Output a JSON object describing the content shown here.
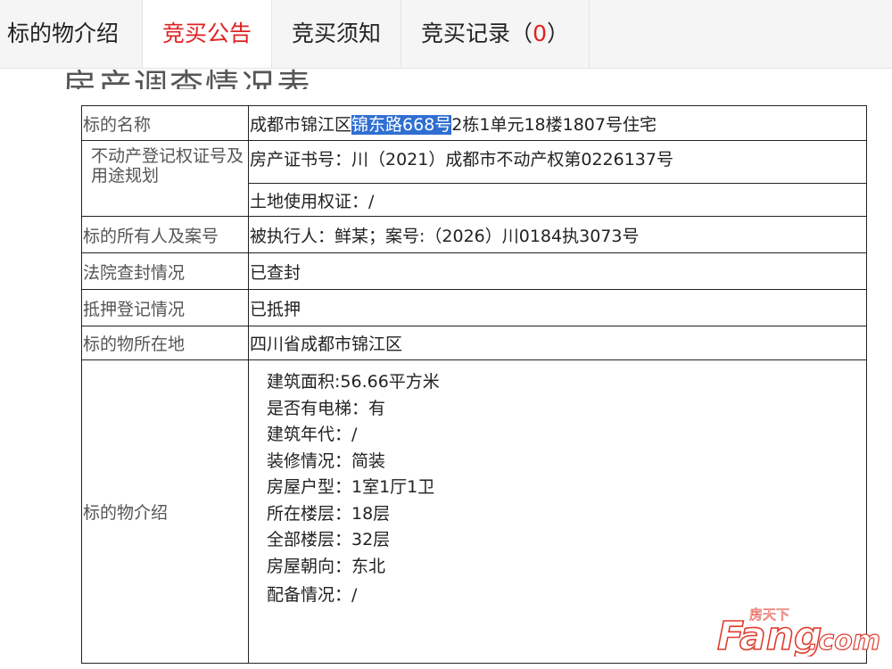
{
  "tabs": [
    {
      "label": "标的物介绍"
    },
    {
      "label": "竞买公告"
    },
    {
      "label": "竞买须知"
    },
    {
      "label": "竞买记录（",
      "count": "0",
      "suffix": "）"
    }
  ],
  "heading": "房产调查情况表",
  "table": {
    "name": {
      "label": "标的名称",
      "prefix": "成都市锦江区",
      "highlight": "锦东路668号",
      "suffix": "2栋1单元18楼1807号住宅"
    },
    "cert": {
      "label": "不动产登记权证号及用途规划",
      "property_cert": "房产证书号：川（2021）成都市不动产权第0226137号",
      "land_cert": "土地使用权证：/"
    },
    "owner": {
      "label": "标的所有人及案号",
      "value": "被执行人：鲜某；案号:（2026）川0184执3073号"
    },
    "seizure": {
      "label": "法院查封情况",
      "value": "已查封"
    },
    "mortgage": {
      "label": "抵押登记情况",
      "value": "已抵押"
    },
    "location": {
      "label": "标的物所在地",
      "value": "四川省成都市锦江区"
    },
    "intro": {
      "label": "标的物介绍",
      "items": [
        "建筑面积:56.66平方米",
        "是否有电梯：有",
        "建筑年代：/",
        "装修情况：简装",
        "房屋户型：1室1厅1卫",
        "所在楼层：18层",
        "全部楼层：32层",
        "房屋朝向：东北",
        "配备情况：/"
      ]
    }
  },
  "watermark": {
    "top_text": "房天下",
    "brand": "Fang",
    "domain": ".com",
    "color": "#e03c2e"
  }
}
